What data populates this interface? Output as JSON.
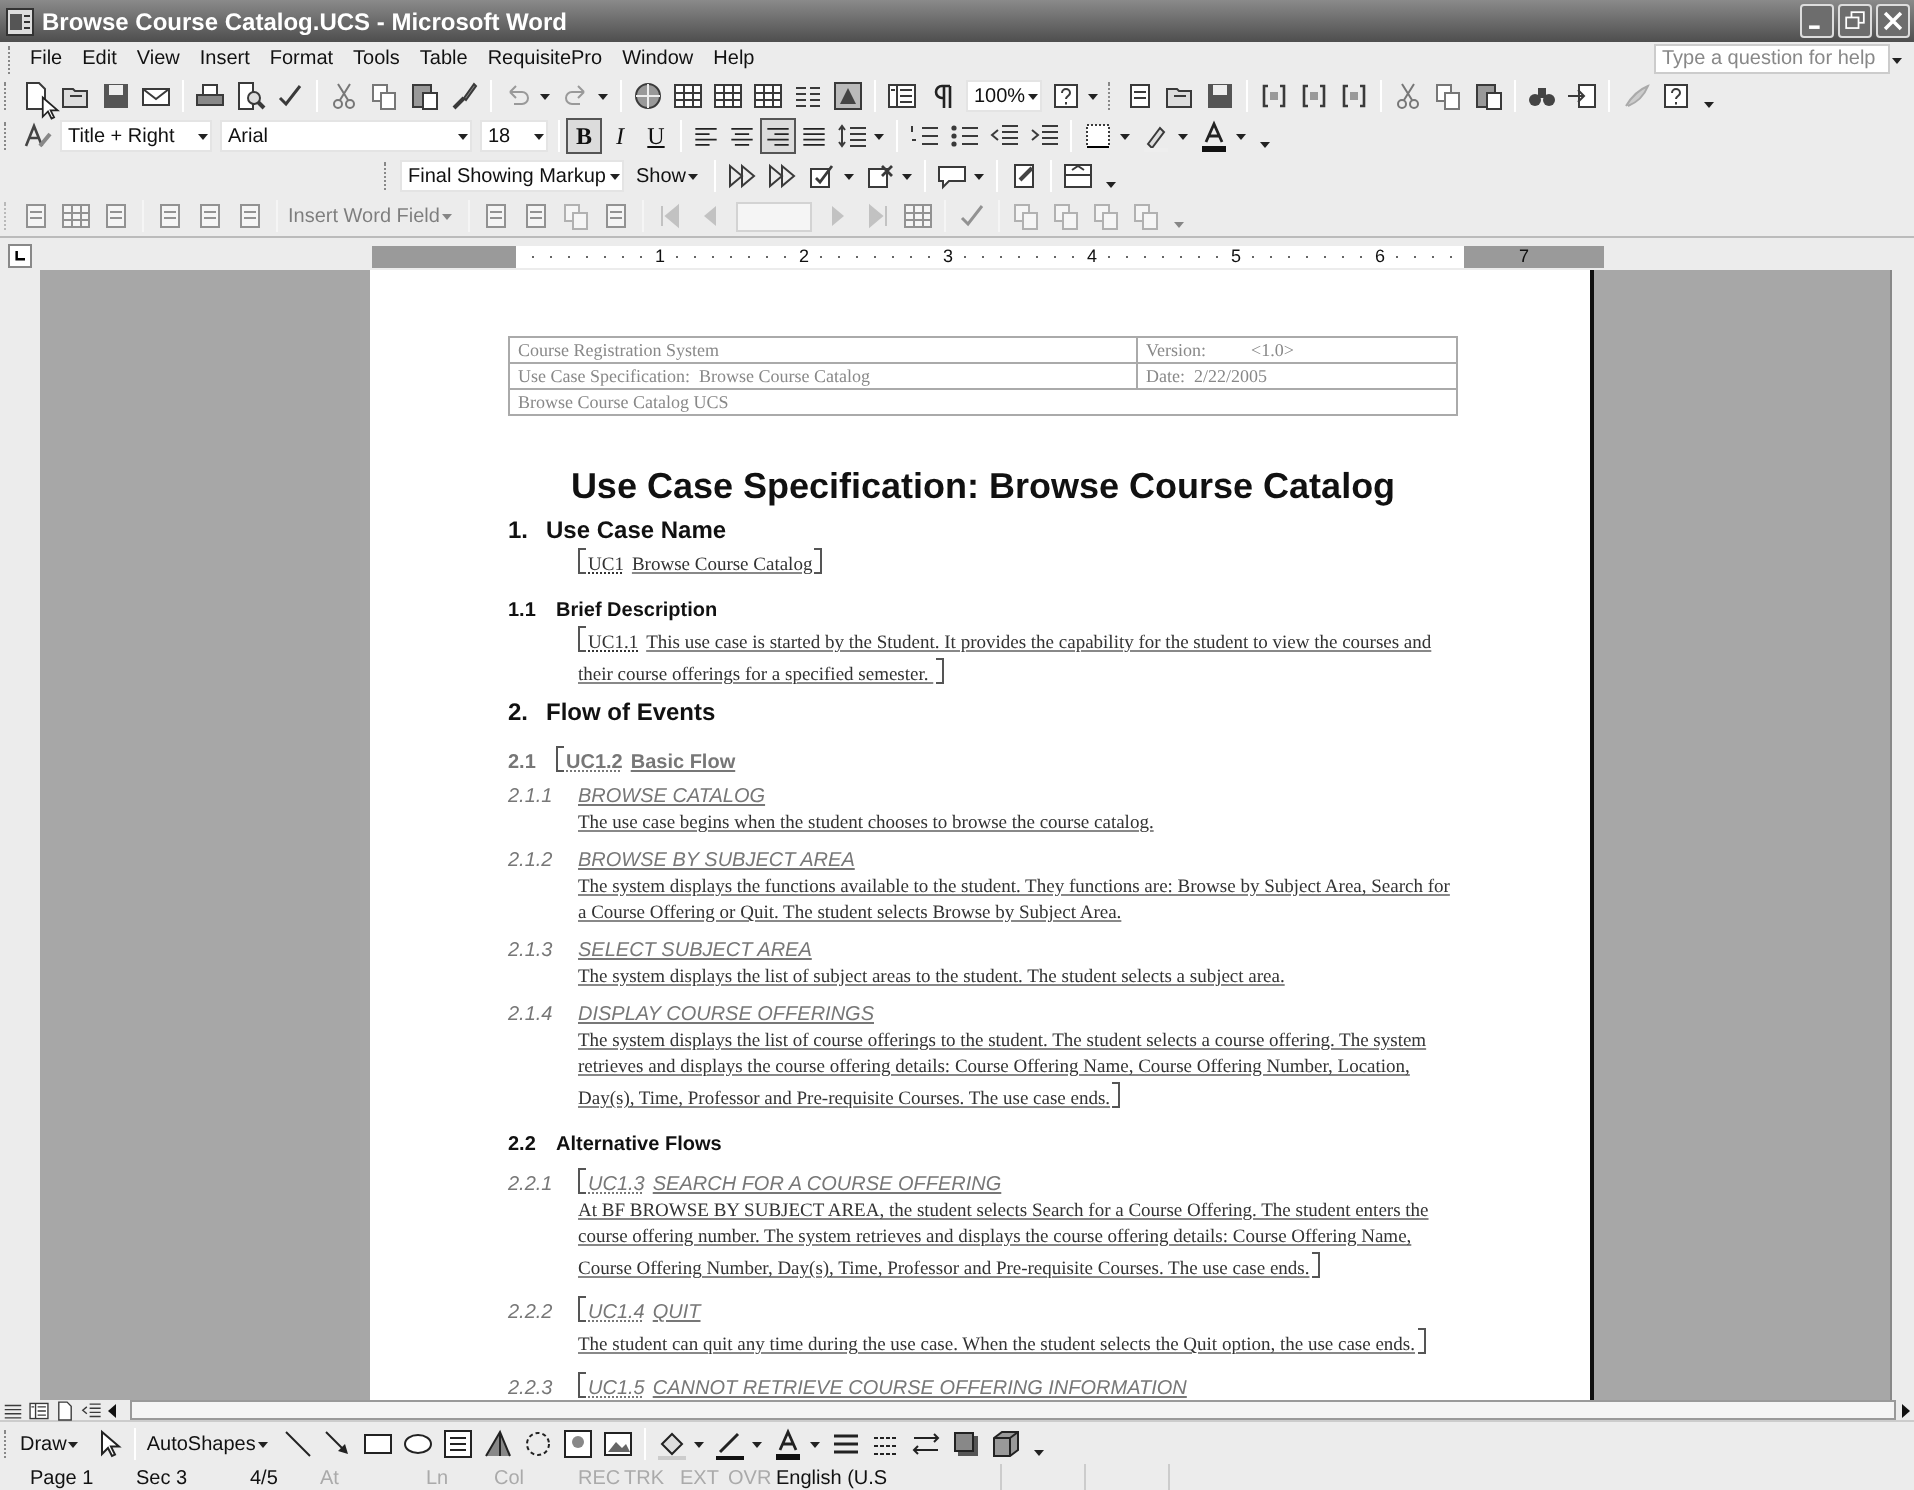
{
  "window": {
    "title": "Browse Course Catalog.UCS - Microsoft Word"
  },
  "menu": [
    "File",
    "Edit",
    "View",
    "Insert",
    "Format",
    "Tools",
    "Table",
    "RequisitePro",
    "Window",
    "Help"
  ],
  "help_field": {
    "placeholder": "Type a question for help"
  },
  "standard_toolbar": {
    "zoom": "100%"
  },
  "formatting_toolbar": {
    "style": "Title + Right",
    "font": "Arial",
    "size": "18",
    "text_buttons": [
      {
        "label": "B",
        "kind": "bold",
        "pressed": true
      },
      {
        "label": "I",
        "kind": "italic",
        "pressed": false
      },
      {
        "label": "U",
        "kind": "underline",
        "pressed": false
      }
    ],
    "alignment": [
      {
        "kind": "left",
        "selected": false
      },
      {
        "kind": "center",
        "selected": false
      },
      {
        "kind": "right",
        "selected": true
      },
      {
        "kind": "justify",
        "selected": false
      }
    ]
  },
  "reviewing_toolbar": {
    "display": "Final Showing Markup",
    "show": "Show"
  },
  "mail_merge_toolbar": {
    "insert_field": "Insert Word Field",
    "disabled": true
  },
  "ruler": [
    "1",
    "2",
    "3",
    "4",
    "5",
    "6",
    "7"
  ],
  "header_table": {
    "rows": [
      {
        "left": "Course Registration System",
        "right_label": "Version:",
        "right_value": "<1.0>"
      },
      {
        "left": "Use Case Specification:  Browse Course Catalog",
        "right_label": "Date:",
        "right_value": "2/22/2005"
      },
      {
        "left": "Browse Course Catalog UCS"
      }
    ]
  },
  "document": {
    "title": "Use Case Specification: Browse Course Catalog",
    "blocks": [
      {
        "kind": "h1",
        "number": "1.",
        "text": "Use Case Name"
      },
      {
        "kind": "para",
        "tag": "UC1",
        "text": "Browse Course Catalog",
        "open": true,
        "close": true
      },
      {
        "kind": "h2",
        "number": "1.1",
        "text": "Brief Description"
      },
      {
        "kind": "para",
        "tag": "UC1.1",
        "text": "This use case is started by the Student. It provides the capability for the student to view the courses and their course offerings for a specified semester.  ",
        "open": true,
        "close": true
      },
      {
        "kind": "h1",
        "number": "2.",
        "text": "Flow of Events"
      },
      {
        "kind": "h2",
        "number": "2.1",
        "tag": "UC1.2",
        "text": "Basic Flow",
        "open": true,
        "close": false
      },
      {
        "kind": "h3",
        "number": "2.1.1",
        "text": "BROWSE CATALOG"
      },
      {
        "kind": "para",
        "text": "The use case begins when the student chooses to browse the course catalog.",
        "open": false,
        "close": false
      },
      {
        "kind": "h3",
        "number": "2.1.2",
        "text": "BROWSE BY SUBJECT AREA"
      },
      {
        "kind": "para",
        "text": "The system displays the functions available to the student.  They functions are:  Browse by Subject Area, Search for a Course Offering or Quit.  The student selects Browse by Subject Area.",
        "open": false,
        "close": false
      },
      {
        "kind": "h3",
        "number": "2.1.3",
        "text": "SELECT SUBJECT AREA"
      },
      {
        "kind": "para",
        "text": "The system displays the list of subject areas to the student.  The student selects a subject area.",
        "open": false,
        "close": false
      },
      {
        "kind": "h3",
        "number": "2.1.4",
        "text": "DISPLAY COURSE OFFERINGS"
      },
      {
        "kind": "para",
        "text": "The system displays the list of course offerings to the student.  The student selects a course offering.   The system retrieves and displays the course offering details: Course Offering Name, Course Offering Number, Location, Day(s), Time, Professor and Pre-requisite Courses.  The use case ends.",
        "open": false,
        "close": true
      },
      {
        "kind": "h2",
        "number": "2.2",
        "text": "Alternative Flows"
      },
      {
        "kind": "h3",
        "number": "2.2.1",
        "tag": "UC1.3",
        "text": "SEARCH FOR A COURSE OFFERING",
        "open": true,
        "close": false
      },
      {
        "kind": "para",
        "text": "At BF BROWSE BY SUBJECT AREA, the student selects Search for a Course Offering.  The student enters the course offering number.  The system retrieves and displays the course offering details: Course Offering Name, Course Offering Number, Day(s), Time, Professor and Pre-requisite Courses.  The use case ends.",
        "open": false,
        "close": true
      },
      {
        "kind": "h3",
        "number": "2.2.2",
        "tag": "UC1.4",
        "text": "QUIT",
        "open": true,
        "close": false
      },
      {
        "kind": "para",
        "text": "The student can quit any time during the use case.  When the student selects the Quit option, the use case ends.",
        "open": false,
        "close": true
      },
      {
        "kind": "h3",
        "number": "2.2.3",
        "tag": "UC1.5",
        "text": "CANNOT RETRIEVE COURSE OFFERING INFORMATION",
        "open": true,
        "close": false
      }
    ]
  },
  "drawing_toolbar": {
    "draw": "Draw",
    "autoshapes": "AutoShapes"
  },
  "status_bar": [
    {
      "label": "Page 1",
      "disabled": false
    },
    {
      "label": "Sec 3",
      "disabled": false
    },
    {
      "label": "4/5",
      "disabled": false
    },
    {
      "label": "At",
      "disabled": true
    },
    {
      "label": "Ln",
      "disabled": true
    },
    {
      "label": "Col",
      "disabled": true
    },
    {
      "label": "REC",
      "disabled": true
    },
    {
      "label": "TRK",
      "disabled": true
    },
    {
      "label": "EXT",
      "disabled": true
    },
    {
      "label": "OVR",
      "disabled": true
    },
    {
      "label": "English (U.S",
      "disabled": false
    }
  ]
}
